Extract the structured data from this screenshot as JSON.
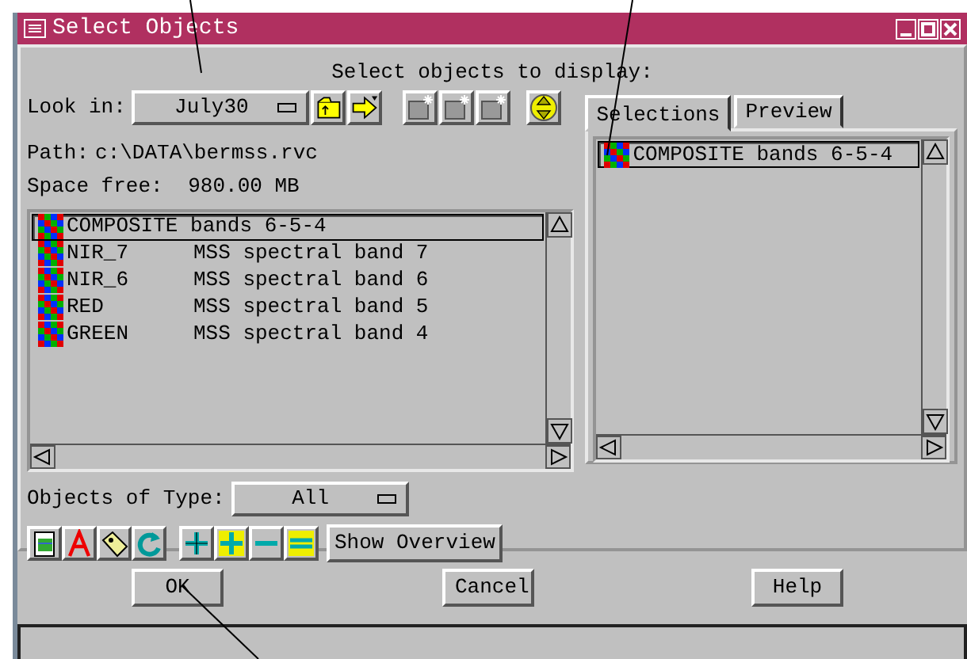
{
  "window": {
    "title": "Select Objects"
  },
  "header": "Select objects to display:",
  "look_in": {
    "label": "Look in:",
    "value": "July30"
  },
  "path": {
    "label": "Path:",
    "value": "c:\\DATA\\bermss.rvc"
  },
  "space_free": {
    "label": "Space free:",
    "value": "980.00 MB"
  },
  "objects": [
    {
      "name": "COMPOSITE bands 6-5-4",
      "selected": true,
      "kind": "composite"
    },
    {
      "name": "NIR_7",
      "description": "MSS spectral band 7",
      "selected": false,
      "kind": "band"
    },
    {
      "name": "NIR_6",
      "description": "MSS spectral band 6",
      "selected": false,
      "kind": "band"
    },
    {
      "name": "RED",
      "description": "MSS spectral band 5",
      "selected": false,
      "kind": "band"
    },
    {
      "name": "GREEN",
      "description": "MSS spectral band 4",
      "selected": false,
      "kind": "band"
    }
  ],
  "tabs": [
    {
      "label": "Selections",
      "selected": true
    },
    {
      "label": "Preview",
      "selected": false
    }
  ],
  "selections": [
    {
      "name": "COMPOSITE bands 6-5-4",
      "selected": true
    }
  ],
  "objects_of_type": {
    "label": "Objects of Type:",
    "value": "All"
  },
  "show_overview": "Show Overview",
  "buttons": [
    "OK",
    "Cancel",
    "Help"
  ]
}
